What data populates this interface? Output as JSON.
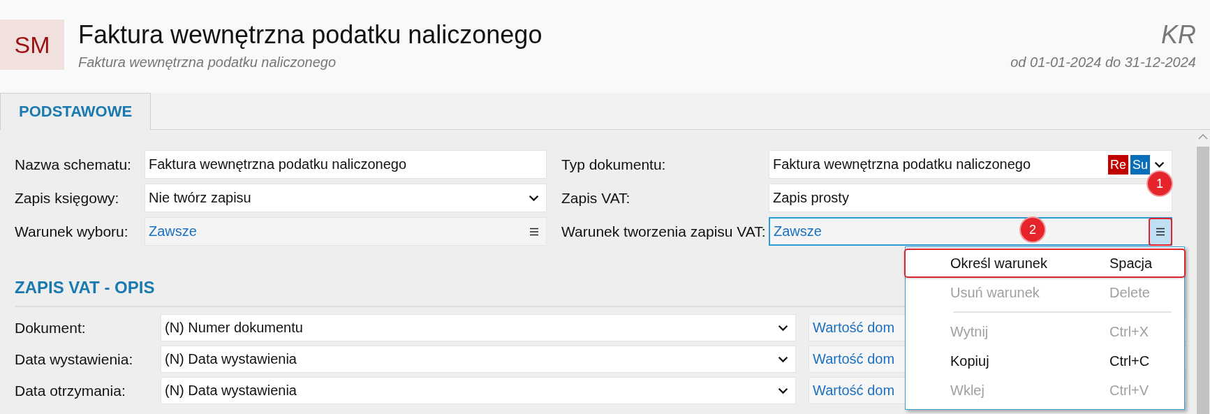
{
  "header": {
    "logo": "SM",
    "title": "Faktura wewnętrzna podatku naliczonego",
    "subtitle": "Faktura wewnętrzna podatku naliczonego",
    "company": "KR",
    "period": "od 01-01-2024 do 31-12-2024"
  },
  "tabs": [
    {
      "label": "PODSTAWOWE",
      "selected": true
    }
  ],
  "form_rows": [
    {
      "left": {
        "label": "Nazwa schematu:",
        "kind": "text",
        "value": "Faktura wewnętrzna podatku naliczonego"
      },
      "right": {
        "label": "Typ dokumentu:",
        "kind": "select",
        "value": "Faktura wewnętrzna podatku naliczonego",
        "tags": [
          {
            "label": "Re",
            "color": "#c00000"
          },
          {
            "label": "Su",
            "color": "#0a6fb8"
          }
        ]
      }
    },
    {
      "left": {
        "label": "Zapis księgowy:",
        "kind": "select",
        "value": "Nie twórz zapisu"
      },
      "right": {
        "label": "Zapis VAT:",
        "kind": "text",
        "value": "Zapis prosty",
        "callout": "1"
      }
    },
    {
      "left": {
        "label": "Warunek wyboru:",
        "kind": "condition",
        "value": "Zawsze",
        "focused": false
      },
      "right": {
        "label": "Warunek tworzenia zapisu VAT:",
        "kind": "condition",
        "value": "Zawsze",
        "focused": true,
        "callout": "2"
      }
    }
  ],
  "section": {
    "title": "ZAPIS VAT - OPIS",
    "rows": [
      {
        "label": "Dokument:",
        "value": "(N) Numer dokumentu",
        "default": "Wartość dom"
      },
      {
        "label": "Data wystawienia:",
        "value": "(N) Data wystawienia",
        "default": "Wartość dom"
      },
      {
        "label": "Data otrzymania:",
        "value": "(N) Data wystawienia",
        "default": "Wartość dom"
      }
    ]
  },
  "context_menu": {
    "items": [
      {
        "kind": "item",
        "label": "Określ warunek",
        "shortcut": "Spacja",
        "disabled": false,
        "highlighted": true
      },
      {
        "kind": "item",
        "label": "Usuń warunek",
        "shortcut": "Delete",
        "disabled": true,
        "highlighted": false
      },
      {
        "kind": "separator"
      },
      {
        "kind": "item",
        "label": "Wytnij",
        "shortcut": "Ctrl+X",
        "disabled": true,
        "highlighted": false
      },
      {
        "kind": "item",
        "label": "Kopiuj",
        "shortcut": "Ctrl+C",
        "disabled": false,
        "highlighted": false
      },
      {
        "kind": "item",
        "label": "Wklej",
        "shortcut": "Ctrl+V",
        "disabled": true,
        "highlighted": false
      }
    ]
  }
}
